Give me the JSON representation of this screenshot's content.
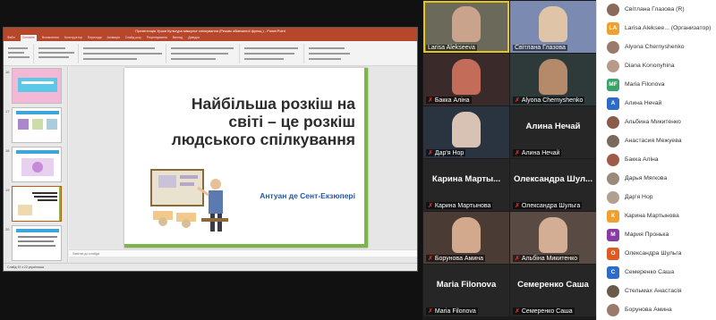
{
  "ppt": {
    "window_title": "Презентація Уроки Культура міжкульт спілкування (Режим обмеженої функц.) - PowerPoint",
    "tabs": [
      "Файл",
      "Основне",
      "Вставлення",
      "Конструктор",
      "Переходи",
      "Анімація",
      "Слайд-шоу",
      "Рецензування",
      "Вигляд",
      "Довідка"
    ],
    "active_tab": "Основне",
    "thumb_numbers": [
      "16",
      "17",
      "18",
      "19",
      "20"
    ],
    "slide": {
      "title": "Найбільша розкіш на світі – це розкіш людського спілкування",
      "author": "Антуан де Сент-Екзюпері"
    },
    "notes_placeholder": "Замітки до слайда",
    "status_text": "Слайд 19 з 22   українська"
  },
  "video_tiles": [
    {
      "name": "Larisa Alekseeva",
      "type": "video",
      "speaker": true,
      "muted": false,
      "bg": "#6b6a5a",
      "face": "#c9a38c"
    },
    {
      "name": "Світлана Глазова",
      "type": "video",
      "speaker": false,
      "muted": false,
      "bg": "#7b8ab0",
      "face": "#e0c4a8"
    },
    {
      "name": "Бакка Аліна",
      "type": "video",
      "speaker": false,
      "muted": true,
      "bg": "#3a2a2a",
      "face": "#c46c5a"
    },
    {
      "name": "Alyona Chernyshenko",
      "type": "video",
      "speaker": false,
      "muted": true,
      "bg": "#2e3a3a",
      "face": "#b48a6a"
    },
    {
      "name": "Дар'я Нор",
      "type": "video",
      "speaker": false,
      "muted": true,
      "bg": "#2a3340",
      "face": "#d8c2b4"
    },
    {
      "name": "Алина Нечай",
      "type": "text",
      "big": "Алина Нечай",
      "muted": true
    },
    {
      "name": "Карина Мартынова",
      "type": "text",
      "big": "Карина Марты...",
      "muted": true
    },
    {
      "name": "Олександра Шульга",
      "type": "text",
      "big": "Олександра Шул...",
      "muted": true
    },
    {
      "name": "Борунова Амина",
      "type": "video",
      "speaker": false,
      "muted": true,
      "bg": "#4a3b35",
      "face": "#d2a98c"
    },
    {
      "name": "Альбіна Микитенко",
      "type": "video",
      "speaker": false,
      "muted": true,
      "bg": "#5a4a44",
      "face": "#d4ae94"
    },
    {
      "name": "Maria Filonova",
      "type": "text",
      "big": "Maria Filonova",
      "muted": true
    },
    {
      "name": "Семеренко Саша",
      "type": "text",
      "big": "Семеренко Саша",
      "muted": true
    }
  ],
  "participants": [
    {
      "name": "Світлана Глазова (R)",
      "initials": "",
      "color": "#8a6a5a"
    },
    {
      "name": "Larisa Alekseе... (Организатор)",
      "initials": "LA",
      "color": "#f0a030"
    },
    {
      "name": "Alyona Chernyshenko",
      "initials": "",
      "color": "#9a7a6a"
    },
    {
      "name": "Diana Kononyhina",
      "initials": "",
      "color": "#b89a8a"
    },
    {
      "name": "Maria Filonova",
      "initials": "MF",
      "color": "#3aa36a"
    },
    {
      "name": "Алина Нечай",
      "initials": "А",
      "color": "#2c6bc9"
    },
    {
      "name": "Альбина Микитенко",
      "initials": "",
      "color": "#8a5a4a"
    },
    {
      "name": "Анастасия Межуева",
      "initials": "",
      "color": "#7a6a5a"
    },
    {
      "name": "Бакка Аліна",
      "initials": "",
      "color": "#a05a4a"
    },
    {
      "name": "Дарья Мягкова",
      "initials": "",
      "color": "#9a8a7a"
    },
    {
      "name": "Дар'я Нор",
      "initials": "",
      "color": "#b0a090"
    },
    {
      "name": "Карина Мартынова",
      "initials": "К",
      "color": "#f0a030"
    },
    {
      "name": "Мария Пронька",
      "initials": "М",
      "color": "#8a3aa3"
    },
    {
      "name": "Олександра Шульга",
      "initials": "О",
      "color": "#e05a20"
    },
    {
      "name": "Семеренко Саша",
      "initials": "С",
      "color": "#2c6bc9"
    },
    {
      "name": "Стельмах Анастасія",
      "initials": "",
      "color": "#6a5a4a"
    },
    {
      "name": "Борунова Амина",
      "initials": "",
      "color": "#9a7a6a"
    }
  ]
}
